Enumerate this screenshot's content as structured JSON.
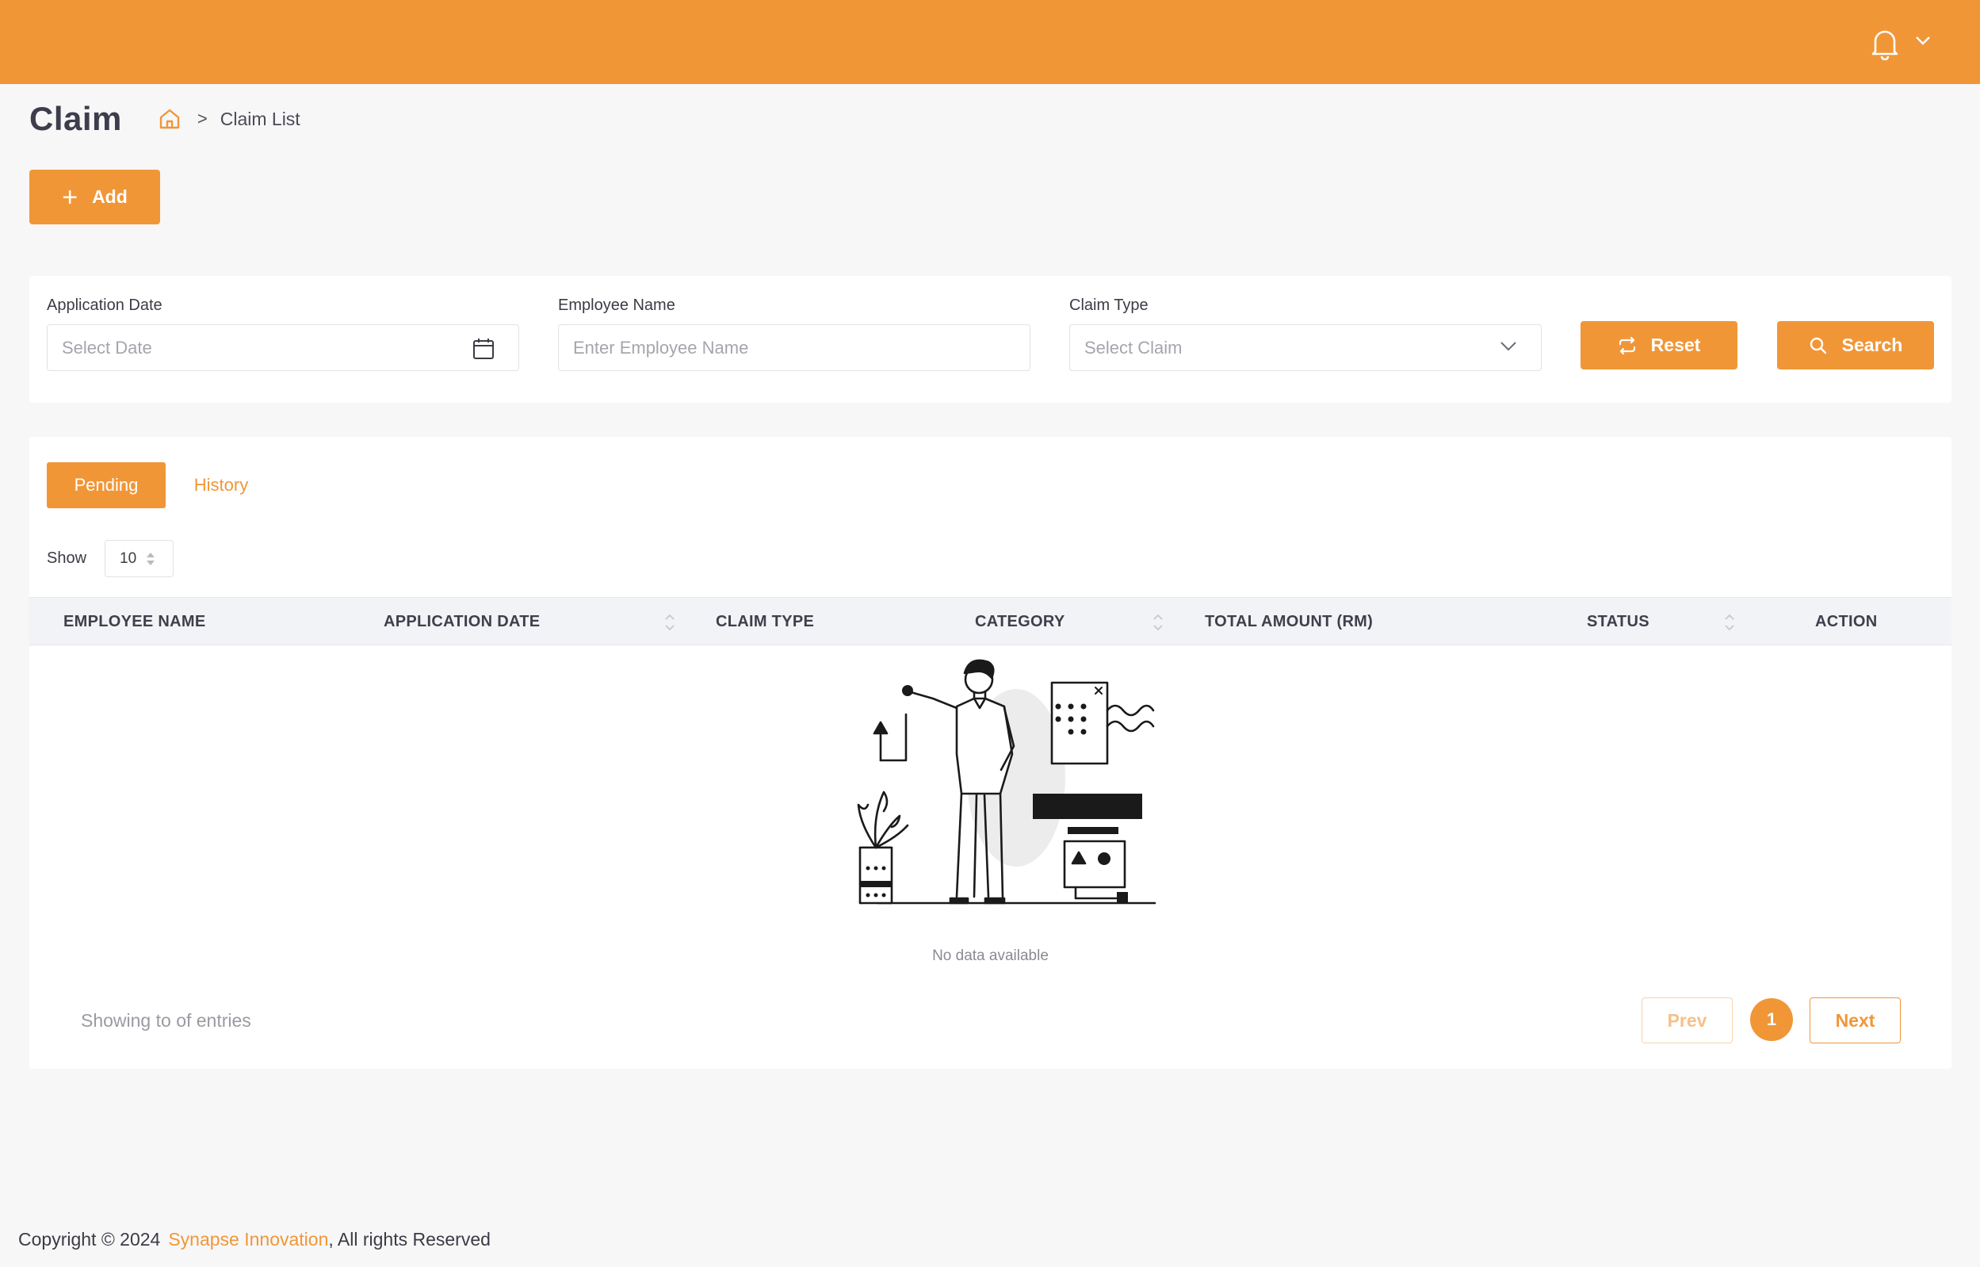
{
  "colors": {
    "accent": "#f19637",
    "background": "#f7f7f8"
  },
  "topbar": {
    "icons": [
      "bell-icon",
      "chevron-down-icon"
    ]
  },
  "header": {
    "title": "Claim",
    "breadcrumb_current": "Claim List"
  },
  "actions": {
    "add_label": "Add"
  },
  "filters": {
    "application_date": {
      "label": "Application Date",
      "placeholder": "Select Date"
    },
    "employee_name": {
      "label": "Employee Name",
      "placeholder": "Enter Employee Name"
    },
    "claim_type": {
      "label": "Claim Type",
      "placeholder": "Select Claim"
    },
    "reset_label": "Reset",
    "search_label": "Search"
  },
  "tabs": {
    "pending": "Pending",
    "history": "History"
  },
  "table": {
    "show_label": "Show",
    "page_size": "10",
    "columns": [
      "EMPLOYEE NAME",
      "APPLICATION DATE",
      "CLAIM TYPE",
      "CATEGORY",
      "TOTAL AMOUNT (RM)",
      "STATUS",
      "ACTION"
    ],
    "empty_text": "No data available"
  },
  "pagination": {
    "summary": "Showing to of entries",
    "prev": "Prev",
    "current": "1",
    "next": "Next"
  },
  "footer": {
    "copyright": "Copyright © 2024",
    "brand": "Synapse Innovation",
    "suffix": ", All rights Reserved"
  }
}
